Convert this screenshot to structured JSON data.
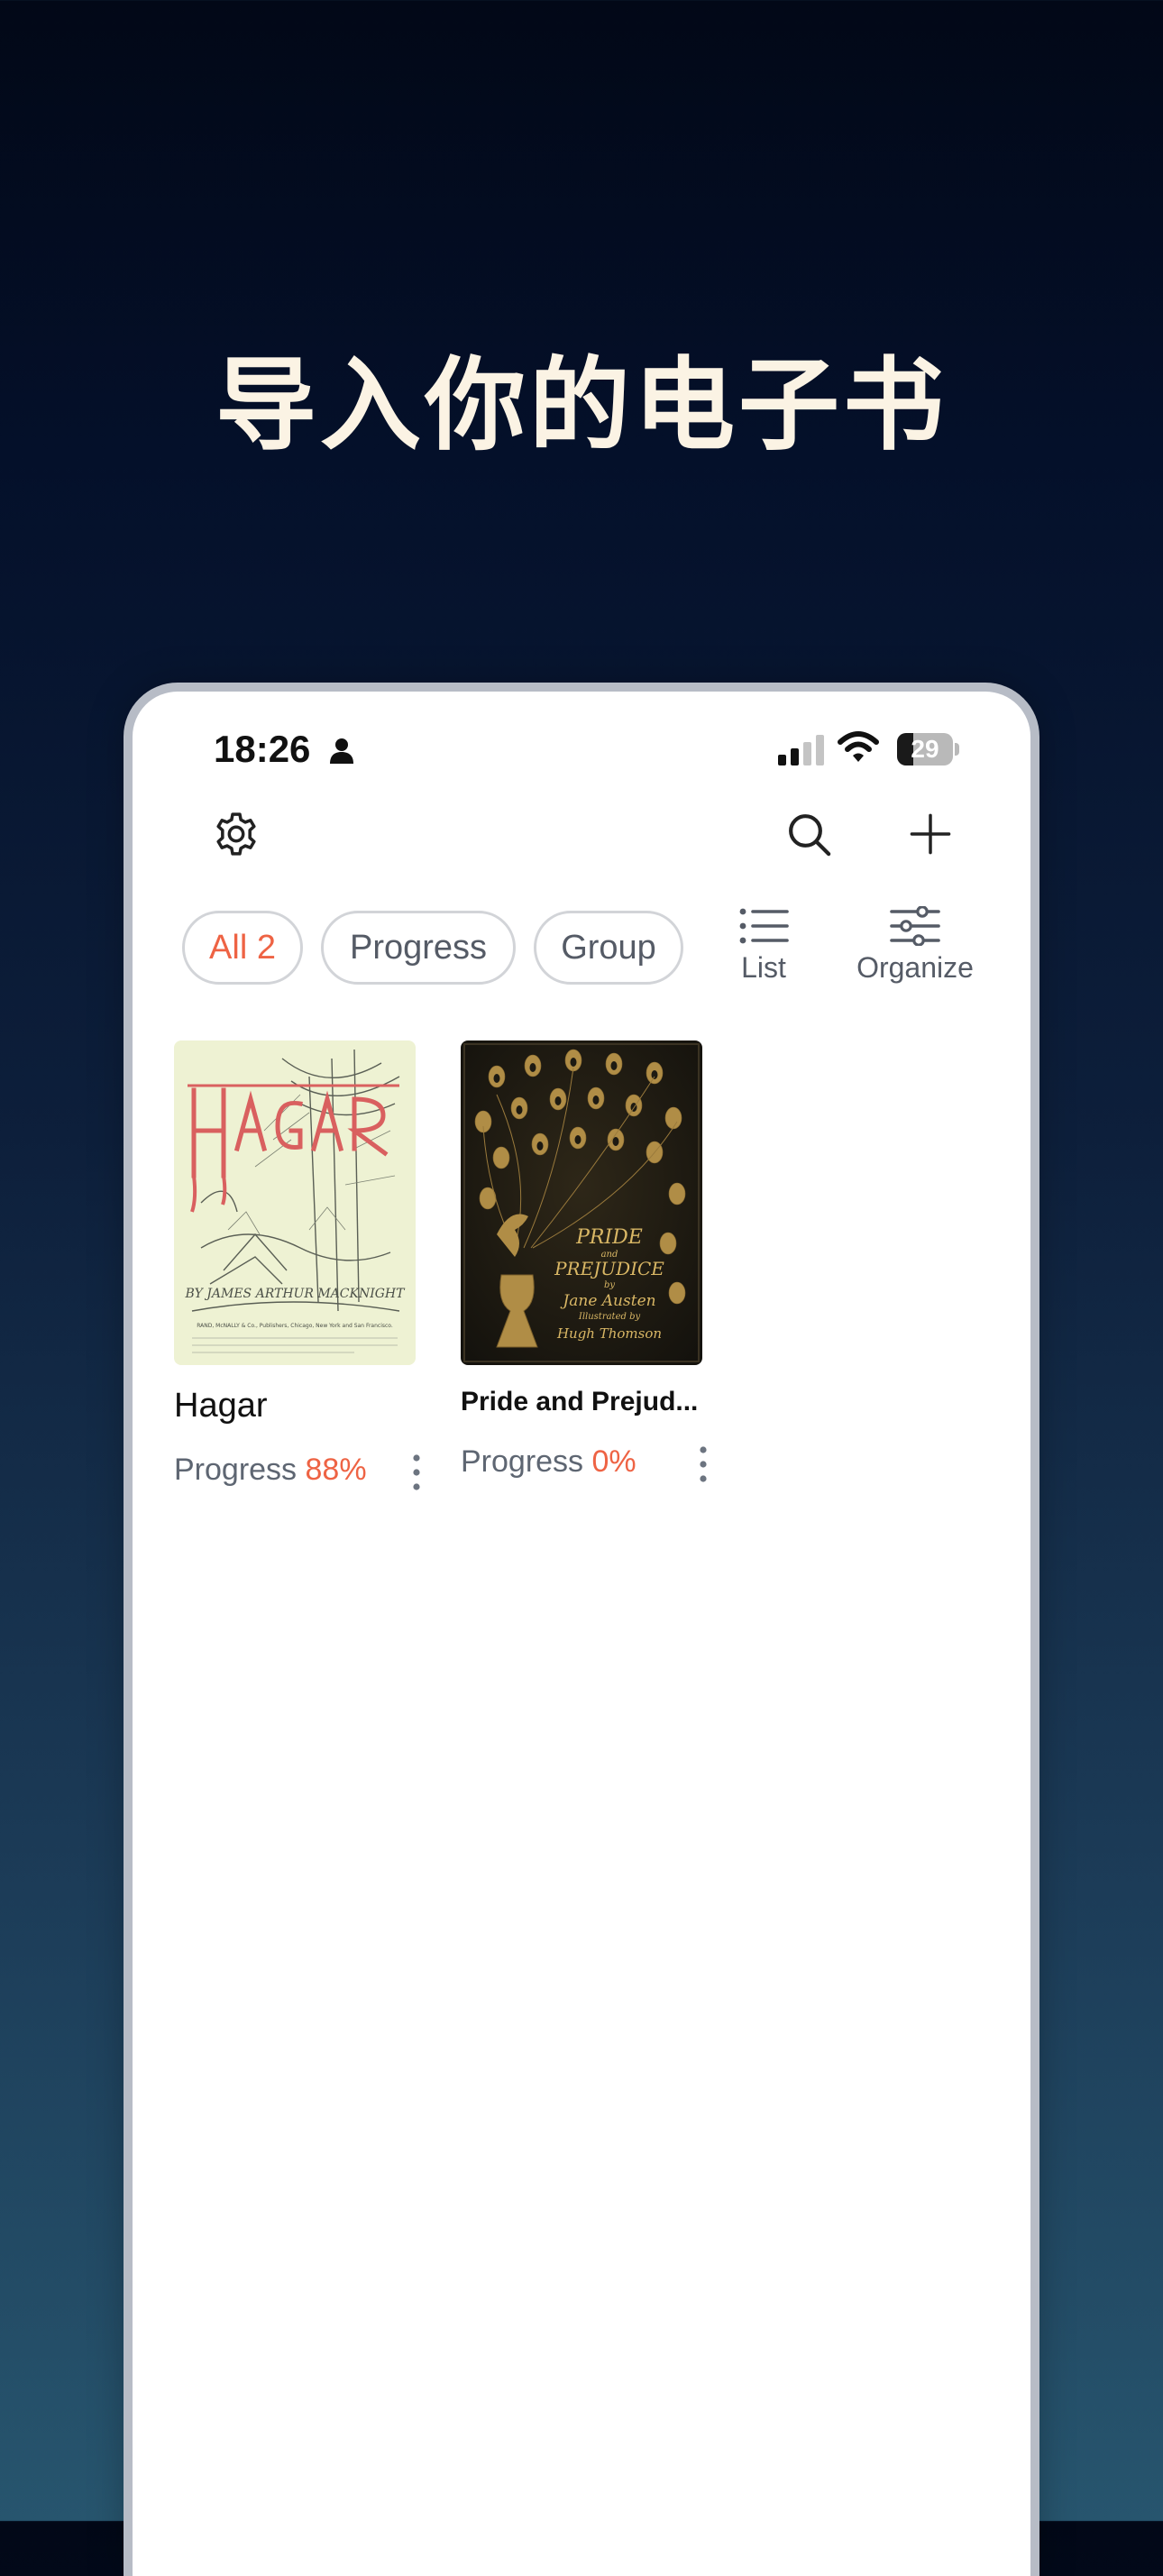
{
  "headline": "导入你的电子书",
  "status_bar": {
    "time": "18:26",
    "battery_level": "29"
  },
  "toolbar": {
    "icons": [
      "settings-icon",
      "search-icon",
      "plus-icon"
    ]
  },
  "filters": {
    "all": "All 2",
    "progress": "Progress",
    "group": "Group"
  },
  "view_options": {
    "list": "List",
    "organize": "Organize"
  },
  "books": [
    {
      "title": "Hagar",
      "progress_label": "Progress",
      "progress_value": "88%",
      "cover": {
        "title_text": "Hagar",
        "author_text": "BY JAMES ARTHUR MACKNIGHT",
        "publisher_text": "RAND, McNALLY & Co., Publishers, Chicago, New York and San Francisco."
      }
    },
    {
      "title": "Pride and Prejud...",
      "progress_label": "Progress",
      "progress_value": "0%",
      "cover": {
        "title_line1": "PRIDE",
        "title_and": "and",
        "title_line2": "PREJUDICE",
        "by": "by",
        "author": "Jane Austen",
        "illustrated": "Illustrated by",
        "illustrator": "Hugh Thomson"
      }
    }
  ],
  "colors": {
    "accent": "#ee6344",
    "chip_border": "#d2d4d8",
    "muted_text": "#5e6672",
    "headline_text": "#fbf3e4"
  }
}
